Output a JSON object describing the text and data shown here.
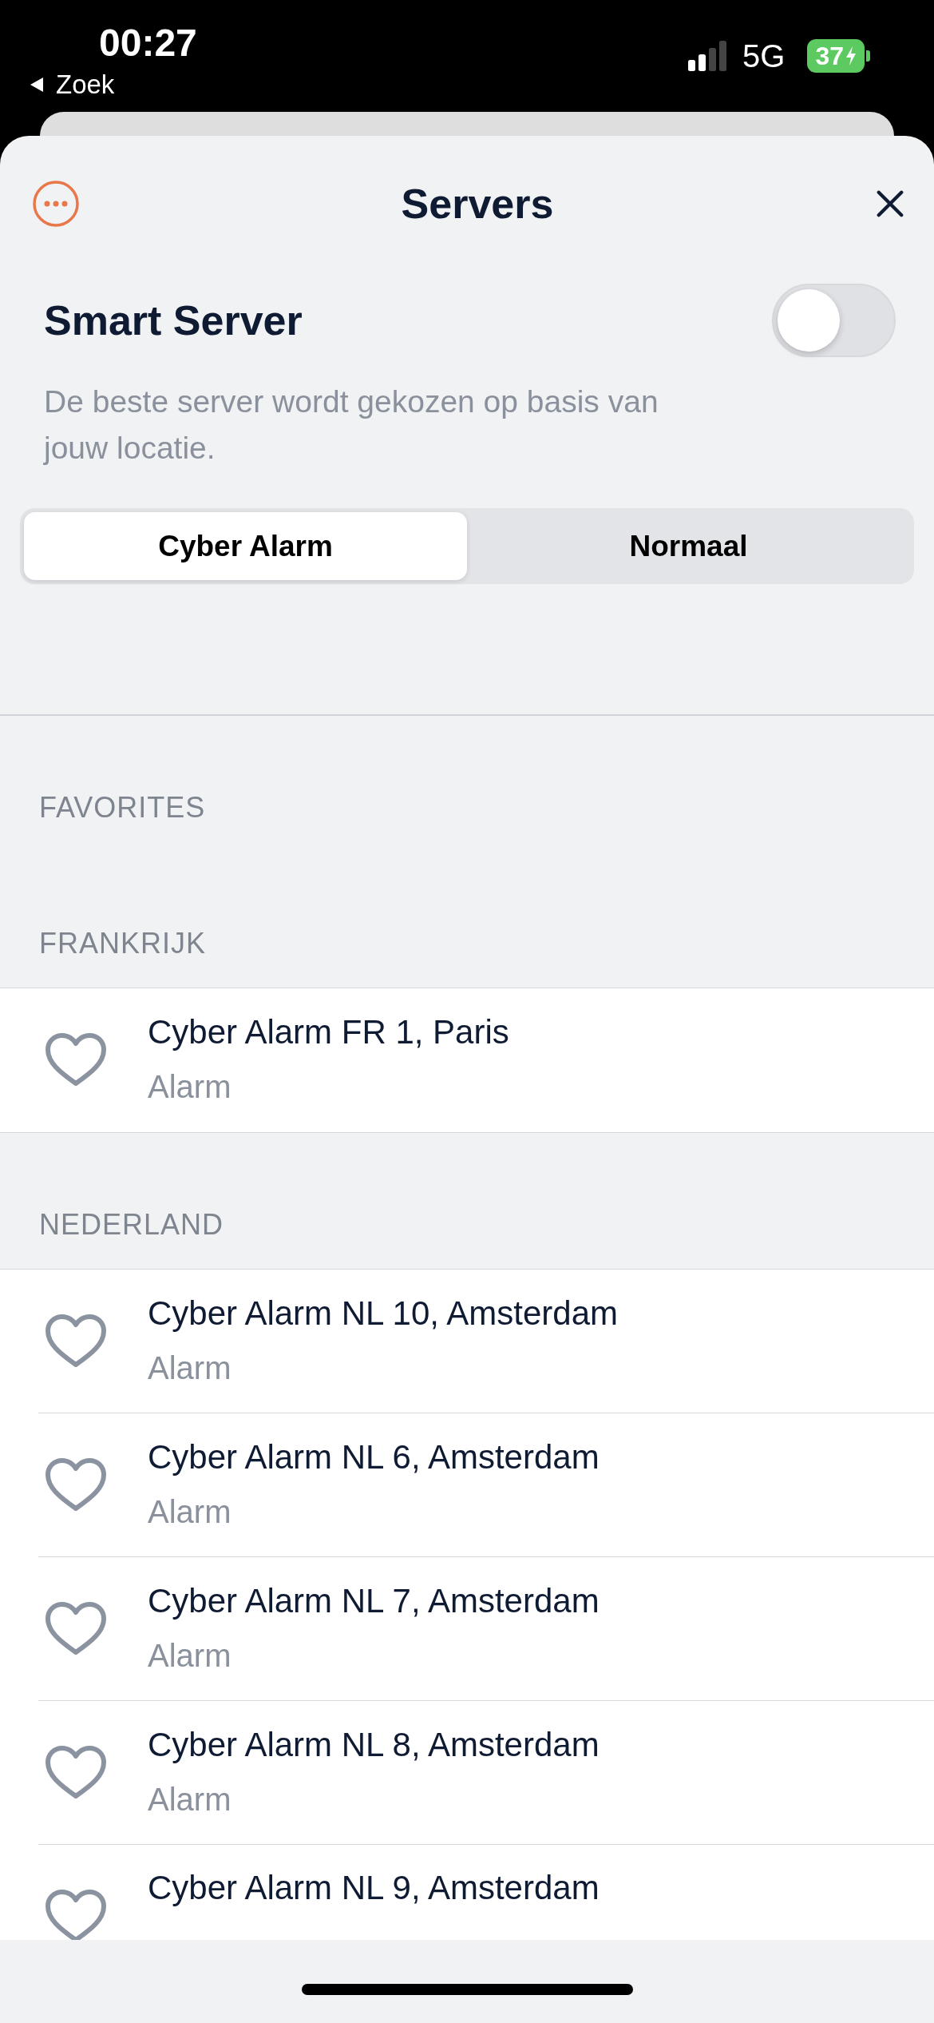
{
  "status_bar": {
    "time": "00:27",
    "back_label": "Zoek",
    "network": "5G",
    "battery": "37"
  },
  "header": {
    "title": "Servers"
  },
  "smart_server": {
    "title": "Smart Server",
    "description": "De beste server wordt gekozen op basis van jouw locatie.",
    "on": false
  },
  "segments": [
    {
      "label": "Cyber Alarm",
      "selected": true
    },
    {
      "label": "Normaal",
      "selected": false
    }
  ],
  "sections": [
    {
      "title": "FAVORITES"
    },
    {
      "title": "FRANKRIJK",
      "servers": [
        {
          "name": "Cyber Alarm FR 1, Paris",
          "type": "Alarm",
          "favorite": false
        }
      ]
    },
    {
      "title": "NEDERLAND",
      "servers": [
        {
          "name": "Cyber Alarm NL 10, Amsterdam",
          "type": "Alarm",
          "favorite": false
        },
        {
          "name": "Cyber Alarm NL 6, Amsterdam",
          "type": "Alarm",
          "favorite": false
        },
        {
          "name": "Cyber Alarm NL 7, Amsterdam",
          "type": "Alarm",
          "favorite": false
        },
        {
          "name": "Cyber Alarm NL 8, Amsterdam",
          "type": "Alarm",
          "favorite": false
        },
        {
          "name": "Cyber Alarm NL 9, Amsterdam",
          "favorite": false
        }
      ]
    }
  ]
}
